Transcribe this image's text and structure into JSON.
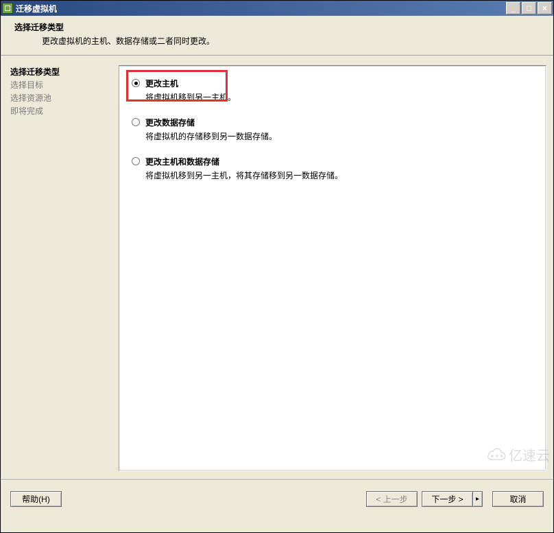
{
  "window": {
    "title": "迁移虚拟机",
    "controls": {
      "min": "_",
      "max": "□",
      "close": "×"
    }
  },
  "header": {
    "title": "选择迁移类型",
    "subtitle": "更改虚拟机的主机、数据存储或二者同时更改。"
  },
  "sidebar": {
    "items": [
      {
        "label": "选择迁移类型",
        "active": true
      },
      {
        "label": "选择目标",
        "active": false
      },
      {
        "label": "选择资源池",
        "active": false
      },
      {
        "label": "即将完成",
        "active": false
      }
    ]
  },
  "options": [
    {
      "title": "更改主机",
      "desc": "将虚拟机移到另一主机。",
      "selected": true
    },
    {
      "title": "更改数据存储",
      "desc": "将虚拟机的存储移到另一数据存储。",
      "selected": false
    },
    {
      "title": "更改主机和数据存储",
      "desc": "将虚拟机移到另一主机，将其存储移到另一数据存储。",
      "selected": false
    }
  ],
  "buttons": {
    "help": "帮助(H)",
    "back": "< 上一步",
    "next": "下一步 >",
    "cancel": "取消"
  },
  "watermark": "亿速云"
}
